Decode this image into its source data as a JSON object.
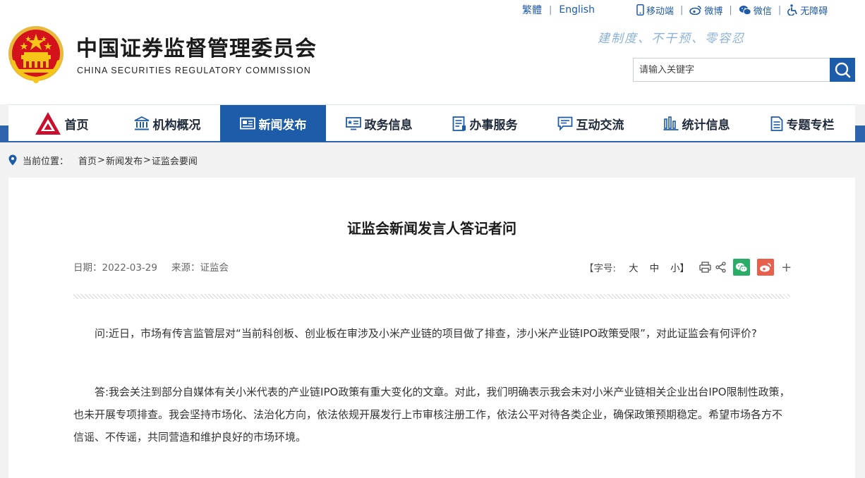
{
  "header": {
    "title_cn": "中国证券监督管理委员会",
    "title_en": "CHINA SECURITIES REGULATORY COMMISSION",
    "slogan": "建制度、不干预、零容忍",
    "top_links": {
      "traditional": "繁體",
      "english": "English",
      "mobile": "移动端",
      "weibo": "微博",
      "wechat": "微信",
      "accessibility": "无障碍"
    },
    "search": {
      "placeholder": "请输入关键字",
      "value": ""
    }
  },
  "nav": {
    "items": [
      {
        "label": "首页",
        "icon": "csrc-logo-icon"
      },
      {
        "label": "机构概况",
        "icon": "building-icon"
      },
      {
        "label": "新闻发布",
        "icon": "newspaper-icon",
        "active": true
      },
      {
        "label": "政务信息",
        "icon": "board-icon"
      },
      {
        "label": "办事服务",
        "icon": "document-icon"
      },
      {
        "label": "互动交流",
        "icon": "chat-icon"
      },
      {
        "label": "统计信息",
        "icon": "bar-chart-icon"
      },
      {
        "label": "专题专栏",
        "icon": "file-icon"
      }
    ]
  },
  "breadcrumb": {
    "label": "当前位置：",
    "items": [
      "首页",
      "新闻发布",
      "证监会要闻"
    ],
    "separator": ">"
  },
  "article": {
    "title": "证监会新闻发言人答记者问",
    "date_label": "日期：",
    "date": "2022-03-29",
    "source_label": "来源：",
    "source": "证监会",
    "font_size_label": "【字号:",
    "font_sizes": [
      "大",
      "中",
      "小】"
    ],
    "question": "问:近日，市场有传言监管层对“当前科创板、创业板在审涉及小米产业链的项目做了排查，涉小米产业链IPO政策受限”，对此证监会有何评价?",
    "answer": "答:我会关注到部分自媒体有关小米代表的产业链IPO政策有重大变化的文章。对此，我们明确表示我会未对小米产业链相关企业出台IPO限制性政策，也未开展专项排查。我会坚持市场化、法治化方向，依法依规开展发行上市审核注册工作，依法公平对待各类企业，确保政策预期稳定。希望市场各方不信谣、不传谣，共同营造和维护良好的市场环境。"
  },
  "colors": {
    "primary_blue": "#1d5ca9",
    "band_blue": "#2e64ad",
    "emblem_red": "#d4121b",
    "emblem_gold": "#f5c518",
    "wechat_green": "#2aae67",
    "weibo_red": "#e8604c",
    "logo_red": "#c8102e"
  }
}
